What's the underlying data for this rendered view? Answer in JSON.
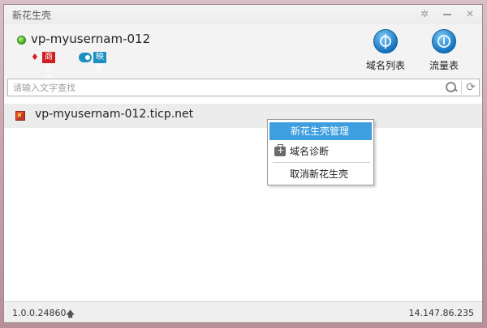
{
  "window": {
    "title": "新花生壳"
  },
  "header": {
    "account": "vp-myusernam-012",
    "badge_business": "商业级",
    "badge_mapping": "映射"
  },
  "toolbar": {
    "domains_label": "域名列表",
    "traffic_label": "流量表"
  },
  "search": {
    "placeholder": "请输入文字查找",
    "value": ""
  },
  "list": {
    "items": [
      {
        "domain": "vp-myusernam-012.ticp.net"
      }
    ]
  },
  "context_menu": {
    "manage": "新花生壳管理",
    "diagnose": "域名诊断",
    "cancel": "取消新花生壳"
  },
  "status": {
    "version": "1.0.0.24860",
    "ip": "14.147.86.235"
  },
  "colors": {
    "menu_highlight": "#3d9fe0",
    "badge_business": "#d11f1f",
    "badge_mapping": "#1b8fbf"
  }
}
